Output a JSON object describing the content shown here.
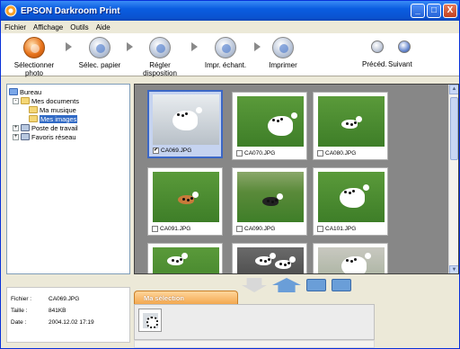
{
  "window": {
    "title": "EPSON Darkroom Print",
    "controls": [
      "_",
      "□",
      "X"
    ]
  },
  "menu": [
    "Fichier",
    "Affichage",
    "Outils",
    "Aide"
  ],
  "toolbar": {
    "steps": [
      {
        "label": "Sélectionner photo",
        "icon": "select-photo-icon",
        "active": true
      },
      {
        "label": "Sélec. papier",
        "icon": "paper-icon",
        "active": false
      },
      {
        "label": "Régler disposition",
        "icon": "layout-icon",
        "active": false
      },
      {
        "label": "Impr. échant.",
        "icon": "sample-print-icon",
        "active": false
      },
      {
        "label": "Imprimer",
        "icon": "print-icon",
        "active": false
      }
    ],
    "nav": {
      "prev": "Précéd.",
      "next": "Suivant"
    }
  },
  "tree": [
    {
      "label": "Bureau",
      "level": 0,
      "expander": ""
    },
    {
      "label": "Mes documents",
      "level": 1,
      "expander": "-"
    },
    {
      "label": "Ma musique",
      "level": 2,
      "expander": ""
    },
    {
      "label": "Mes images",
      "level": 2,
      "expander": "",
      "selected": true
    },
    {
      "label": "Poste de travail",
      "level": 1,
      "expander": "+"
    },
    {
      "label": "Favoris réseau",
      "level": 1,
      "expander": "+"
    }
  ],
  "thumbnails": [
    {
      "name": "CA069.JPG",
      "checked": true,
      "selected": true
    },
    {
      "name": "CA070.JPG",
      "checked": false
    },
    {
      "name": "CA080.JPG",
      "checked": false
    },
    {
      "name": "CA091.JPG",
      "checked": false
    },
    {
      "name": "CA090.JPG",
      "checked": false
    },
    {
      "name": "CA101.JPG",
      "checked": false
    },
    {
      "name": "",
      "checked": false
    },
    {
      "name": "",
      "checked": false
    },
    {
      "name": "",
      "checked": false
    }
  ],
  "scrollbar": {
    "up": "▲",
    "down": "▼"
  },
  "info": {
    "file_label": "Fichier :",
    "file_value": "CA069.JPG",
    "size_label": "Taille :",
    "size_value": "841KB",
    "date_label": "Date :",
    "date_value": "2004.12.02 17:19"
  },
  "selection": {
    "tab_label": "Ma sélection"
  }
}
